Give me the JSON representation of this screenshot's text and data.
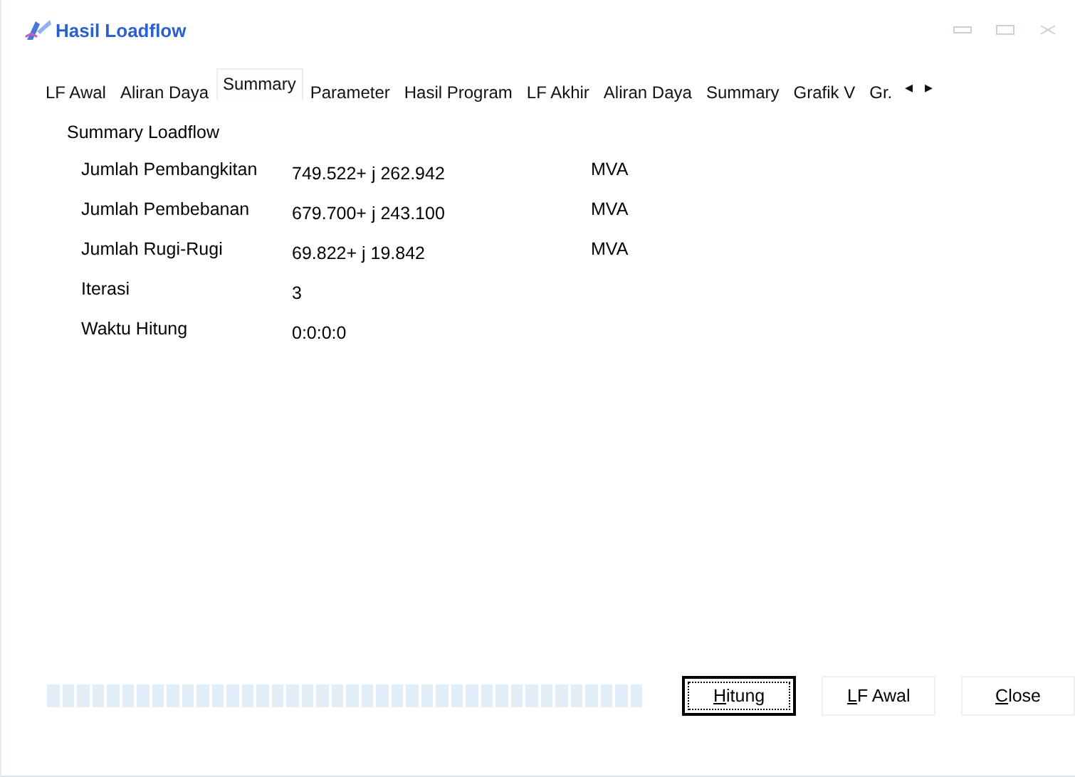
{
  "window": {
    "title": "Hasil Loadflow"
  },
  "tabs": [
    {
      "label": "LF Awal",
      "selected": false
    },
    {
      "label": "Aliran Daya",
      "selected": false
    },
    {
      "label": "Summary",
      "selected": true
    },
    {
      "label": "Parameter",
      "selected": false
    },
    {
      "label": "Hasil Program",
      "selected": false
    },
    {
      "label": "LF Akhir",
      "selected": false
    },
    {
      "label": "Aliran Daya",
      "selected": false
    },
    {
      "label": "Summary",
      "selected": false
    },
    {
      "label": "Grafik V",
      "selected": false
    },
    {
      "label": "Gr.",
      "selected": false
    }
  ],
  "tab_scroll": [
    "◂",
    "▸"
  ],
  "summary": {
    "title": "Summary Loadflow",
    "rows": [
      {
        "label": "Jumlah Pembangkitan",
        "value": "749.522+ j 262.942",
        "unit": "MVA"
      },
      {
        "label": "Jumlah Pembebanan",
        "value": "679.700+ j 243.100",
        "unit": "MVA"
      },
      {
        "label": "Jumlah Rugi-Rugi",
        "value": " 69.822+ j  19.842",
        "unit": "MVA"
      },
      {
        "label": "Iterasi",
        "value": "3"
      },
      {
        "label": "Waktu Hitung",
        "value": "0:0:0:0"
      }
    ]
  },
  "progress": {
    "level": 1
  },
  "buttons": [
    {
      "label": "Hitung",
      "focused": true
    },
    {
      "label": "LF Awal",
      "focused": false
    },
    {
      "label": "Close",
      "focused": false
    }
  ]
}
